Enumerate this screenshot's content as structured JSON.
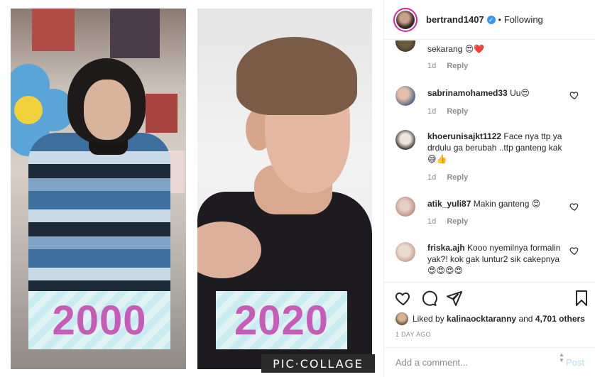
{
  "post": {
    "username": "bertrand1407",
    "separator": "•",
    "following": "Following",
    "year_left": "2000",
    "year_right": "2020",
    "watermark": "PIC·COLLAGE"
  },
  "comments": [
    {
      "user": "",
      "text": "sekarang 😍❤️",
      "time": "1d",
      "reply": "Reply"
    },
    {
      "user": "sabrinamohamed33",
      "text": "Uu😍",
      "time": "1d",
      "reply": "Reply"
    },
    {
      "user": "khoerunisajkt1122",
      "text": "Face nya ttp ya drdulu ga berubah ..ttp ganteng kak 😅👍",
      "time": "1d",
      "reply": "Reply"
    },
    {
      "user": "atik_yuli87",
      "text": "Makin ganteng 😍",
      "time": "1d",
      "reply": "Reply"
    },
    {
      "user": "friska.ajh",
      "text": "Kooo nyemilnya formalin yak?! kok gak luntur2 sik cakepnya 😍😍😍😍",
      "time": "",
      "reply": ""
    }
  ],
  "likes": {
    "prefix": "Liked by",
    "user": "kalinaocktaranny",
    "and": "and",
    "count": "4,701 others"
  },
  "time_ago": "1 DAY AGO",
  "add_comment": {
    "placeholder": "Add a comment...",
    "post_label": "Post"
  },
  "icons": {
    "verified": "verified-badge-icon",
    "heart": "heart-icon",
    "comment": "comment-icon",
    "share": "share-icon",
    "save": "bookmark-icon",
    "scroll": "scroll-arrows-icon"
  },
  "colors": {
    "year_text": "#c55cb6",
    "verified": "#3897f0",
    "post_button": "#b2dffc",
    "meta_text": "#8e8e8e"
  }
}
